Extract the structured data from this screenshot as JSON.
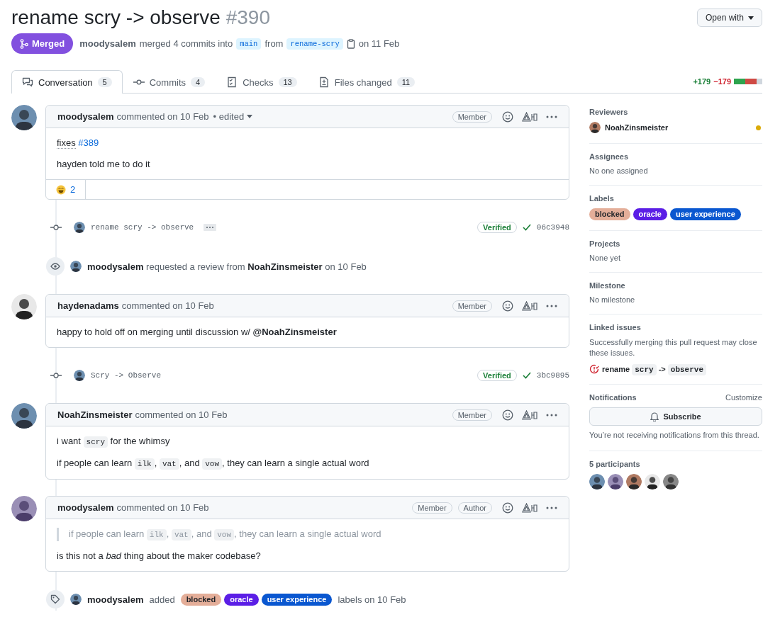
{
  "title": "rename scry -> observe",
  "number": "#390",
  "open_with": "Open with",
  "state": {
    "label": "Merged"
  },
  "summary": {
    "author": "moodysalem",
    "text": "merged 4 commits into",
    "base": "main",
    "from": "from",
    "head": "rename-scry",
    "date": "on 11 Feb"
  },
  "tabs": [
    {
      "kind": "conversation",
      "label": "Conversation",
      "count": "5",
      "selected": true
    },
    {
      "kind": "commits",
      "label": "Commits",
      "count": "4",
      "selected": false
    },
    {
      "kind": "checks",
      "label": "Checks",
      "count": "13",
      "selected": false
    },
    {
      "kind": "files",
      "label": "Files changed",
      "count": "11",
      "selected": false
    }
  ],
  "diffstat": {
    "additions": "+179",
    "deletions": "−179"
  },
  "timeline": [
    {
      "kind": "comment",
      "author": "moodysalem",
      "action": "commented on 10 Feb",
      "edited": "• edited",
      "badges": [
        "Member"
      ],
      "avatar": {
        "kind": "picture"
      },
      "body": [
        {
          "kind": "p",
          "parts": [
            {
              "kind": "abbr",
              "text": "fixes"
            },
            {
              "kind": "link",
              "text": "#389"
            }
          ]
        },
        {
          "kind": "p",
          "parts": [
            {
              "kind": "text",
              "text": "hayden told me to do it"
            }
          ]
        }
      ],
      "reactions": [
        {
          "kind": "laugh",
          "count": "2"
        }
      ]
    },
    {
      "kind": "commit",
      "message": "rename scry -> observe",
      "has_description": true,
      "verified": "Verified",
      "sha": "06c3948"
    },
    {
      "kind": "review_request",
      "actor": "moodysalem",
      "text": "requested a review from",
      "target": "NoahZinsmeister",
      "date": "on 10 Feb"
    },
    {
      "kind": "comment",
      "author": "haydenadams",
      "action": "commented on 10 Feb",
      "badges": [
        "Member"
      ],
      "avatar": {
        "kind": "picture"
      },
      "body": [
        {
          "kind": "p",
          "parts": [
            {
              "kind": "text",
              "text": "happy to hold off on merging until discussion w/ "
            },
            {
              "kind": "mention",
              "text": "@NoahZinsmeister"
            }
          ]
        }
      ]
    },
    {
      "kind": "commit",
      "message": "Scry -> Observe",
      "has_description": false,
      "verified": "Verified",
      "sha": "3bc9895"
    },
    {
      "kind": "comment",
      "author": "NoahZinsmeister",
      "action": "commented on 10 Feb",
      "badges": [
        "Member"
      ],
      "avatar": {
        "kind": "picture"
      },
      "body": [
        {
          "kind": "p",
          "parts": [
            {
              "kind": "text",
              "text": "i want "
            },
            {
              "kind": "code",
              "text": "scry"
            },
            {
              "kind": "text",
              "text": " for the whimsy"
            }
          ]
        },
        {
          "kind": "p",
          "parts": [
            {
              "kind": "text",
              "text": "if people can learn "
            },
            {
              "kind": "code",
              "text": "ilk"
            },
            {
              "kind": "text",
              "text": ", "
            },
            {
              "kind": "code",
              "text": "vat"
            },
            {
              "kind": "text",
              "text": ", and "
            },
            {
              "kind": "code",
              "text": "vow"
            },
            {
              "kind": "text",
              "text": ", they can learn a single actual word"
            }
          ]
        }
      ]
    },
    {
      "kind": "comment",
      "author": "moodysalem",
      "action": "commented on 10 Feb",
      "badges": [
        "Member",
        "Author"
      ],
      "avatar": {
        "kind": "picture"
      },
      "body": [
        {
          "kind": "quote",
          "parts": [
            {
              "kind": "text",
              "text": "if people can learn "
            },
            {
              "kind": "code",
              "text": "ilk"
            },
            {
              "kind": "text",
              "text": ", "
            },
            {
              "kind": "code",
              "text": "vat"
            },
            {
              "kind": "text",
              "text": ", and "
            },
            {
              "kind": "code",
              "text": "vow"
            },
            {
              "kind": "text",
              "text": ", they can learn a single actual word"
            }
          ]
        },
        {
          "kind": "p",
          "parts": [
            {
              "kind": "text",
              "text": "is this not a "
            },
            {
              "kind": "em",
              "text": "bad"
            },
            {
              "kind": "text",
              "text": " thing about the maker codebase?"
            }
          ]
        }
      ]
    },
    {
      "kind": "labeled",
      "actor": "moodysalem",
      "text": "added",
      "labels": [
        {
          "name": "blocked",
          "color": "#e4ae99"
        },
        {
          "name": "oracle",
          "color": "#5b1ee6"
        },
        {
          "name": "user experience",
          "color": "#0a57d0"
        }
      ],
      "suffix": "labels on 10 Feb"
    }
  ],
  "sidebar": {
    "reviewers": {
      "heading": "Reviewers",
      "items": [
        {
          "name": "NoahZinsmeister",
          "color": "#dbab09"
        }
      ]
    },
    "assignees": {
      "heading": "Assignees",
      "empty": "No one assigned"
    },
    "labels": {
      "heading": "Labels",
      "items": [
        {
          "name": "blocked",
          "color": "#e4ae99"
        },
        {
          "name": "oracle",
          "color": "#5b1ee6"
        },
        {
          "name": "user experience",
          "color": "#0a57d0"
        }
      ]
    },
    "projects": {
      "heading": "Projects",
      "empty": "None yet"
    },
    "milestone": {
      "heading": "Milestone",
      "empty": "No milestone"
    },
    "linked_issues": {
      "heading": "Linked issues",
      "note": "Successfully merging this pull request may close these issues.",
      "issues": [
        {
          "parts": [
            {
              "kind": "text",
              "text": "rename "
            },
            {
              "kind": "code",
              "text": "scry"
            },
            {
              "kind": "text",
              "text": " -> "
            },
            {
              "kind": "code",
              "text": "observe"
            }
          ]
        }
      ]
    },
    "notifications": {
      "heading": "Notifications",
      "customize": "Customize",
      "button": "Subscribe",
      "note": "You’re not receiving notifications from this thread."
    },
    "participants": {
      "heading": "5 participants",
      "avatars": [
        {
          "kind": "picture"
        },
        {
          "kind": "picture"
        },
        {
          "kind": "picture"
        },
        {
          "kind": "picture"
        },
        {
          "kind": "picture"
        }
      ]
    }
  }
}
